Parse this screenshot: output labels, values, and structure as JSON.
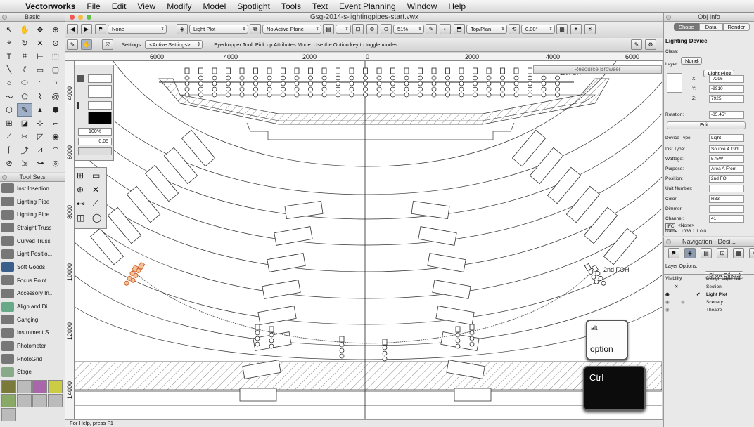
{
  "menubar": {
    "app": "Vectorworks",
    "items": [
      "File",
      "Edit",
      "View",
      "Modify",
      "Model",
      "Spotlight",
      "Tools",
      "Text",
      "Event Planning",
      "Window",
      "Help"
    ]
  },
  "window": {
    "title": "Gsg-2014-s-lightingpipes-start.vwx"
  },
  "basic_palette": {
    "title": "Basic"
  },
  "toolsets": {
    "title": "Tool Sets",
    "items": [
      "Inst Insertion",
      "Lighting Pipe",
      "Lighting Pipe...",
      "Straight Truss",
      "Curved Truss",
      "Light Positio...",
      "Soft Goods",
      "Focus Point",
      "Accessory In...",
      "Align and Di...",
      "Ganging",
      "Instrument S...",
      "Photometer",
      "PhotoGrid",
      "Stage"
    ]
  },
  "viewbar": {
    "class_popup": "None",
    "layer_popup": "Light Plot",
    "plane_popup": "No Active Plane",
    "zoom": "51%",
    "view_popup": "Top/Plan",
    "rotation": "0.00°"
  },
  "modebar": {
    "settings_label": "Settings:",
    "settings_value": "<Active Settings>",
    "help_text": "Eyedropper Tool: Pick up Attributes Mode. Use the Option key to toggle modes."
  },
  "ruler": {
    "h_labels": [
      "6000",
      "4000",
      "2000",
      "0",
      "2000",
      "4000",
      "6000"
    ],
    "v_labels": [
      "4000",
      "6000",
      "8000",
      "10000",
      "12000",
      "14000"
    ]
  },
  "attributes": {
    "opacity": "100%",
    "line_weight": "0.05"
  },
  "resource_browser": {
    "title": "Resource Browser"
  },
  "canvas": {
    "labels": {
      "first_foh": "1st FOH",
      "second_foh": "2nd FOH"
    }
  },
  "obj_info": {
    "title": "Obj Info",
    "tabs": [
      "Shape",
      "Data",
      "Render"
    ],
    "object_type": "Lighting Device",
    "class_label": "Class:",
    "class_value": "None",
    "layer_label": "Layer:",
    "layer_value": "Light Plot",
    "x_label": "X:",
    "x": "-7296",
    "y_label": "Y:",
    "y": "-9910",
    "z_label": "Z:",
    "z": "7925",
    "rotation_label": "Rotation:",
    "rotation": "-35.45°",
    "edit_button": "Edit...",
    "fields": [
      {
        "label": "Device Type:",
        "value": "Light"
      },
      {
        "label": "Inst Type:",
        "value": "Source 4 19d"
      },
      {
        "label": "Wattage:",
        "value": "575W"
      },
      {
        "label": "Purpose:",
        "value": "Area A Front"
      },
      {
        "label": "Position:",
        "value": "2nd FOH"
      },
      {
        "label": "Unit Number:",
        "value": ""
      },
      {
        "label": "Color:",
        "value": "R33"
      },
      {
        "label": "Dimmer:",
        "value": ""
      },
      {
        "label": "Channel:",
        "value": "41"
      }
    ],
    "ifc_label": "IFC",
    "ifc_value": "<None>",
    "name_label": "Name:",
    "name_value": "1033.1.1.0.0"
  },
  "navigation": {
    "title": "Navigation - Desi...",
    "layer_options_label": "Layer Options:",
    "layer_options_value": "Show Others",
    "col_visibility": "Visibility",
    "col_layer": "Design Layer Nar",
    "layers": [
      "Section",
      "Light Plot",
      "Scenery",
      "Theatre"
    ]
  },
  "keys": {
    "alt_top": "alt",
    "alt_bottom": "option",
    "ctrl": "Ctrl"
  },
  "status": {
    "text": "For Help, press F1"
  }
}
